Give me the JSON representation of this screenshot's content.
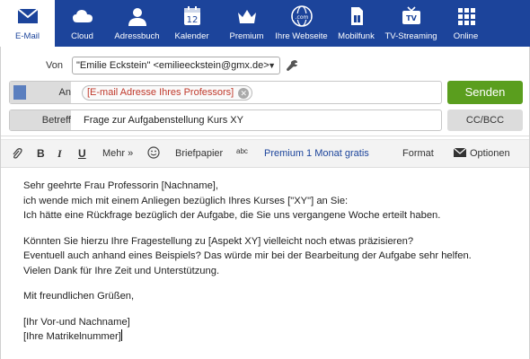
{
  "nav": {
    "items": [
      {
        "label": "E-Mail",
        "icon": "envelope-icon"
      },
      {
        "label": "Cloud",
        "icon": "cloud-icon"
      },
      {
        "label": "Adressbuch",
        "icon": "address-book-icon"
      },
      {
        "label": "Kalender",
        "icon": "calendar-icon",
        "day": "12"
      },
      {
        "label": "Premium",
        "icon": "crown-icon"
      },
      {
        "label": "Ihre Webseite",
        "icon": "website-icon",
        "badge": ".com"
      },
      {
        "label": "Mobilfunk",
        "icon": "sim-card-icon"
      },
      {
        "label": "TV-Streaming",
        "icon": "tv-icon",
        "badge": "TV"
      },
      {
        "label": "Online",
        "icon": "apps-icon"
      }
    ],
    "active_color": "#1c449b"
  },
  "compose": {
    "von_label": "Von",
    "from_value": "\"Emilie Eckstein\" <emilieeckstein@gmx.de>",
    "an_label": "An",
    "recipient": "[E-mail Adresse Ihres Professors]",
    "send_label": "Senden",
    "betreff_label": "Betreff",
    "subject": "Frage zur Aufgabenstellung Kurs XY",
    "ccbcc_label": "CC/BCC"
  },
  "toolbar": {
    "bold": "B",
    "italic": "I",
    "underline": "U",
    "more": "Mehr",
    "paper": "Briefpapier",
    "spell": "abc",
    "premium": "Premium 1 Monat gratis",
    "format": "Format",
    "options": "Optionen"
  },
  "body": {
    "lines": [
      "Sehr geehrte Frau Professorin [Nachname],",
      "ich wende mich mit einem Anliegen bezüglich Ihres Kurses [\"XY\"] an Sie:",
      "Ich hätte eine Rückfrage bezüglich der Aufgabe, die Sie uns vergangene Woche erteilt haben.",
      "Könnten Sie hierzu Ihre Fragestellung zu [Aspekt XY] vielleicht noch etwas präzisieren?",
      "Eventuell auch anhand eines Beispiels? Das würde mir bei der Bearbeitung der Aufgabe sehr helfen.",
      "Vielen Dank für Ihre Zeit und Unterstützung.",
      "Mit freundlichen Grüßen,",
      "[Ihr Vor-und Nachname]",
      "[Ihre Matrikelnummer]"
    ]
  },
  "colors": {
    "nav_bg": "#1c449b",
    "send_bg": "#5a9e1e",
    "recipient_text": "#c0392b",
    "premium_text": "#1c449b"
  }
}
